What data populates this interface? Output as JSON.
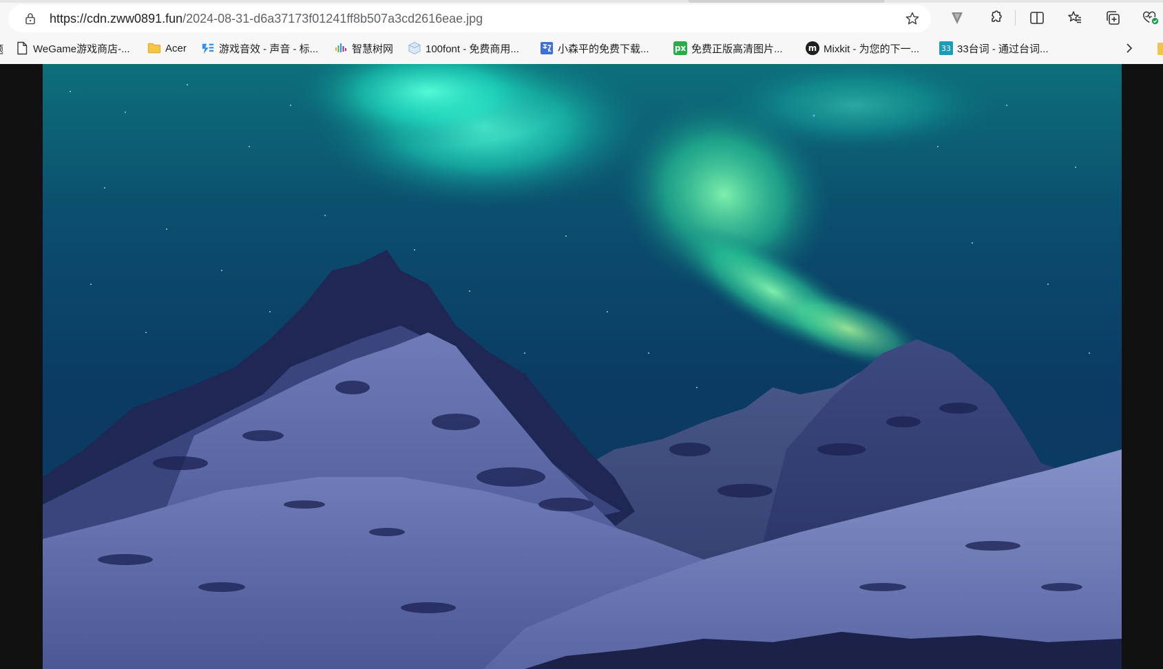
{
  "address_bar": {
    "url_host": "https://cdn.zww0891.fun",
    "url_path": "/2024-08-31-d6a37173f01241ff8b507a3cd2616eae.jpg"
  },
  "toolbar": {
    "icons": [
      "lock-icon",
      "star-icon",
      "vpn-extension-icon",
      "extensions-icon",
      "split-screen-icon",
      "favorites-icon",
      "collections-icon",
      "browser-essentials-icon"
    ]
  },
  "bookmarks": {
    "clipped_left_label": "题",
    "items": [
      {
        "label": "WeGame游戏商店-...",
        "icon": "page-icon"
      },
      {
        "label": "Acer",
        "icon": "folder-icon"
      },
      {
        "label": "游戏音效 - 声音 - 标...",
        "icon": "sound-logo-icon"
      },
      {
        "label": "智慧树网",
        "icon": "zhihuishu-icon"
      },
      {
        "label": "100font - 免费商用...",
        "icon": "100font-icon"
      },
      {
        "label": "小森平的免费下载...",
        "icon": "kosenhei-icon"
      },
      {
        "label": "免费正版高清图片...",
        "icon": "px-icon"
      },
      {
        "label": "Mixkit - 为您的下一...",
        "icon": "mixkit-icon"
      },
      {
        "label": "33台词 - 通过台词...",
        "icon": "33-icon"
      }
    ],
    "icon_texts": {
      "px": "px",
      "mixkit": "m",
      "n33": "33"
    }
  },
  "colors": {
    "chrome_bg": "#f7f7f7",
    "viewer_bg": "#111111",
    "aurora": "#2de8c8",
    "sky_top": "#0e3d5c",
    "snow": "#7a86bf"
  }
}
